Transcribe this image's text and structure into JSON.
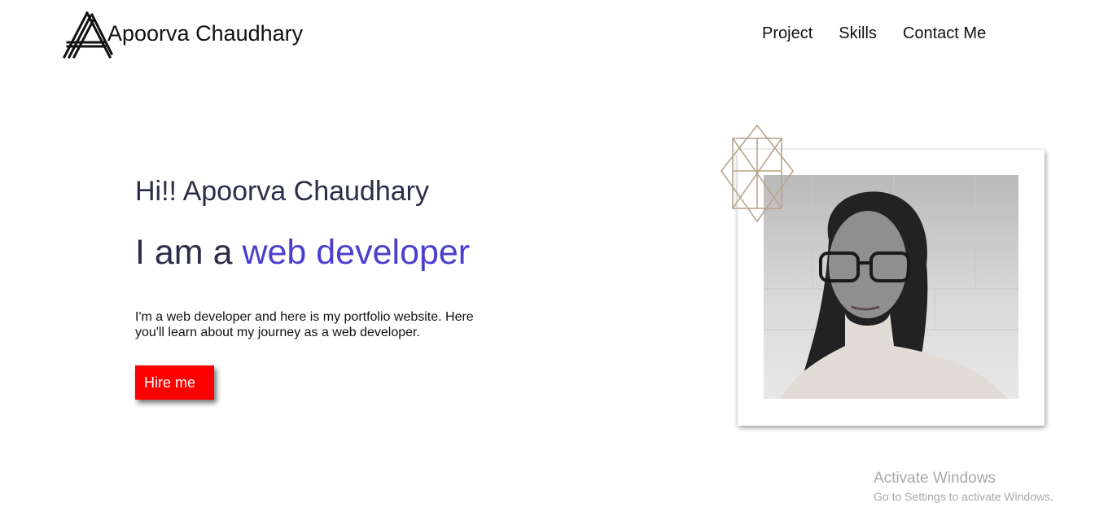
{
  "header": {
    "logo_text": "Apoorva Chaudhary",
    "nav": [
      {
        "label": "Project"
      },
      {
        "label": "Skills"
      },
      {
        "label": "Contact Me"
      }
    ]
  },
  "hero": {
    "greeting": "Hi!! Apoorva Chaudhary",
    "title_prefix": "I am a ",
    "title_accent": "web developer",
    "description": "I'm a web developer and here is my portfolio website. Here you'll learn about my journey as a web developer.",
    "cta_label": "Hire me"
  },
  "colors": {
    "accent": "#4a3fcf",
    "heading": "#2b2d4a",
    "cta": "#ff0000"
  },
  "watermark": {
    "title": "Activate Windows",
    "subtitle": "Go to Settings to activate Windows."
  }
}
